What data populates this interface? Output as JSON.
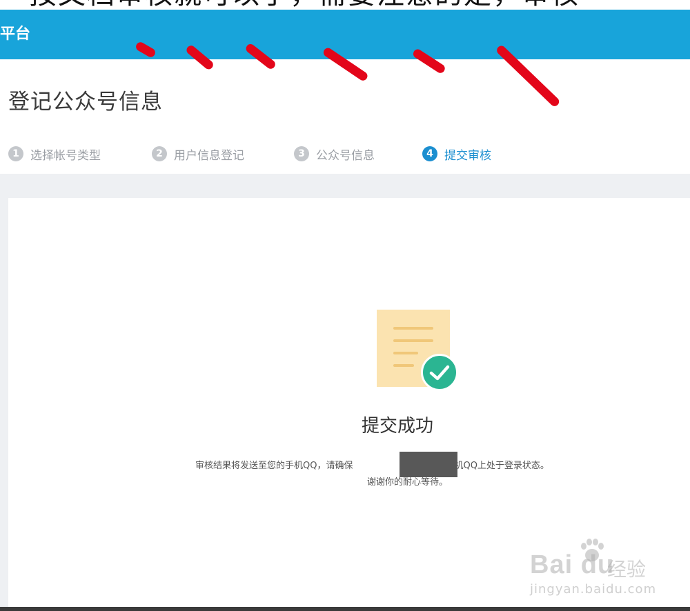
{
  "caption": "按文档审核就可以了，需要注意的是，审核",
  "header": {
    "title": "平台"
  },
  "page": {
    "title": "登记公众号信息"
  },
  "steps": [
    {
      "num": "1",
      "label": "选择帐号类型",
      "active": false
    },
    {
      "num": "2",
      "label": "用户信息登记",
      "active": false
    },
    {
      "num": "3",
      "label": "公众号信息",
      "active": false
    },
    {
      "num": "4",
      "label": "提交审核",
      "active": true
    }
  ],
  "result": {
    "title": "提交成功",
    "message_part1": "审核结果将发送至您的手机QQ，请确保",
    "message_part2": "的号码在手机QQ上处于登录状态。",
    "message_line2": "谢谢你的耐心等待。"
  },
  "watermark": {
    "logo": "Bai du",
    "text": "经验",
    "url": "jingyan.baidu.com"
  },
  "colors": {
    "header": "#18a4da",
    "active_step": "#1c8fd0",
    "success": "#2bb592",
    "annotation_marks": "#e3061a"
  },
  "icons": {
    "document": "document-icon",
    "check": "check-circle-icon"
  }
}
